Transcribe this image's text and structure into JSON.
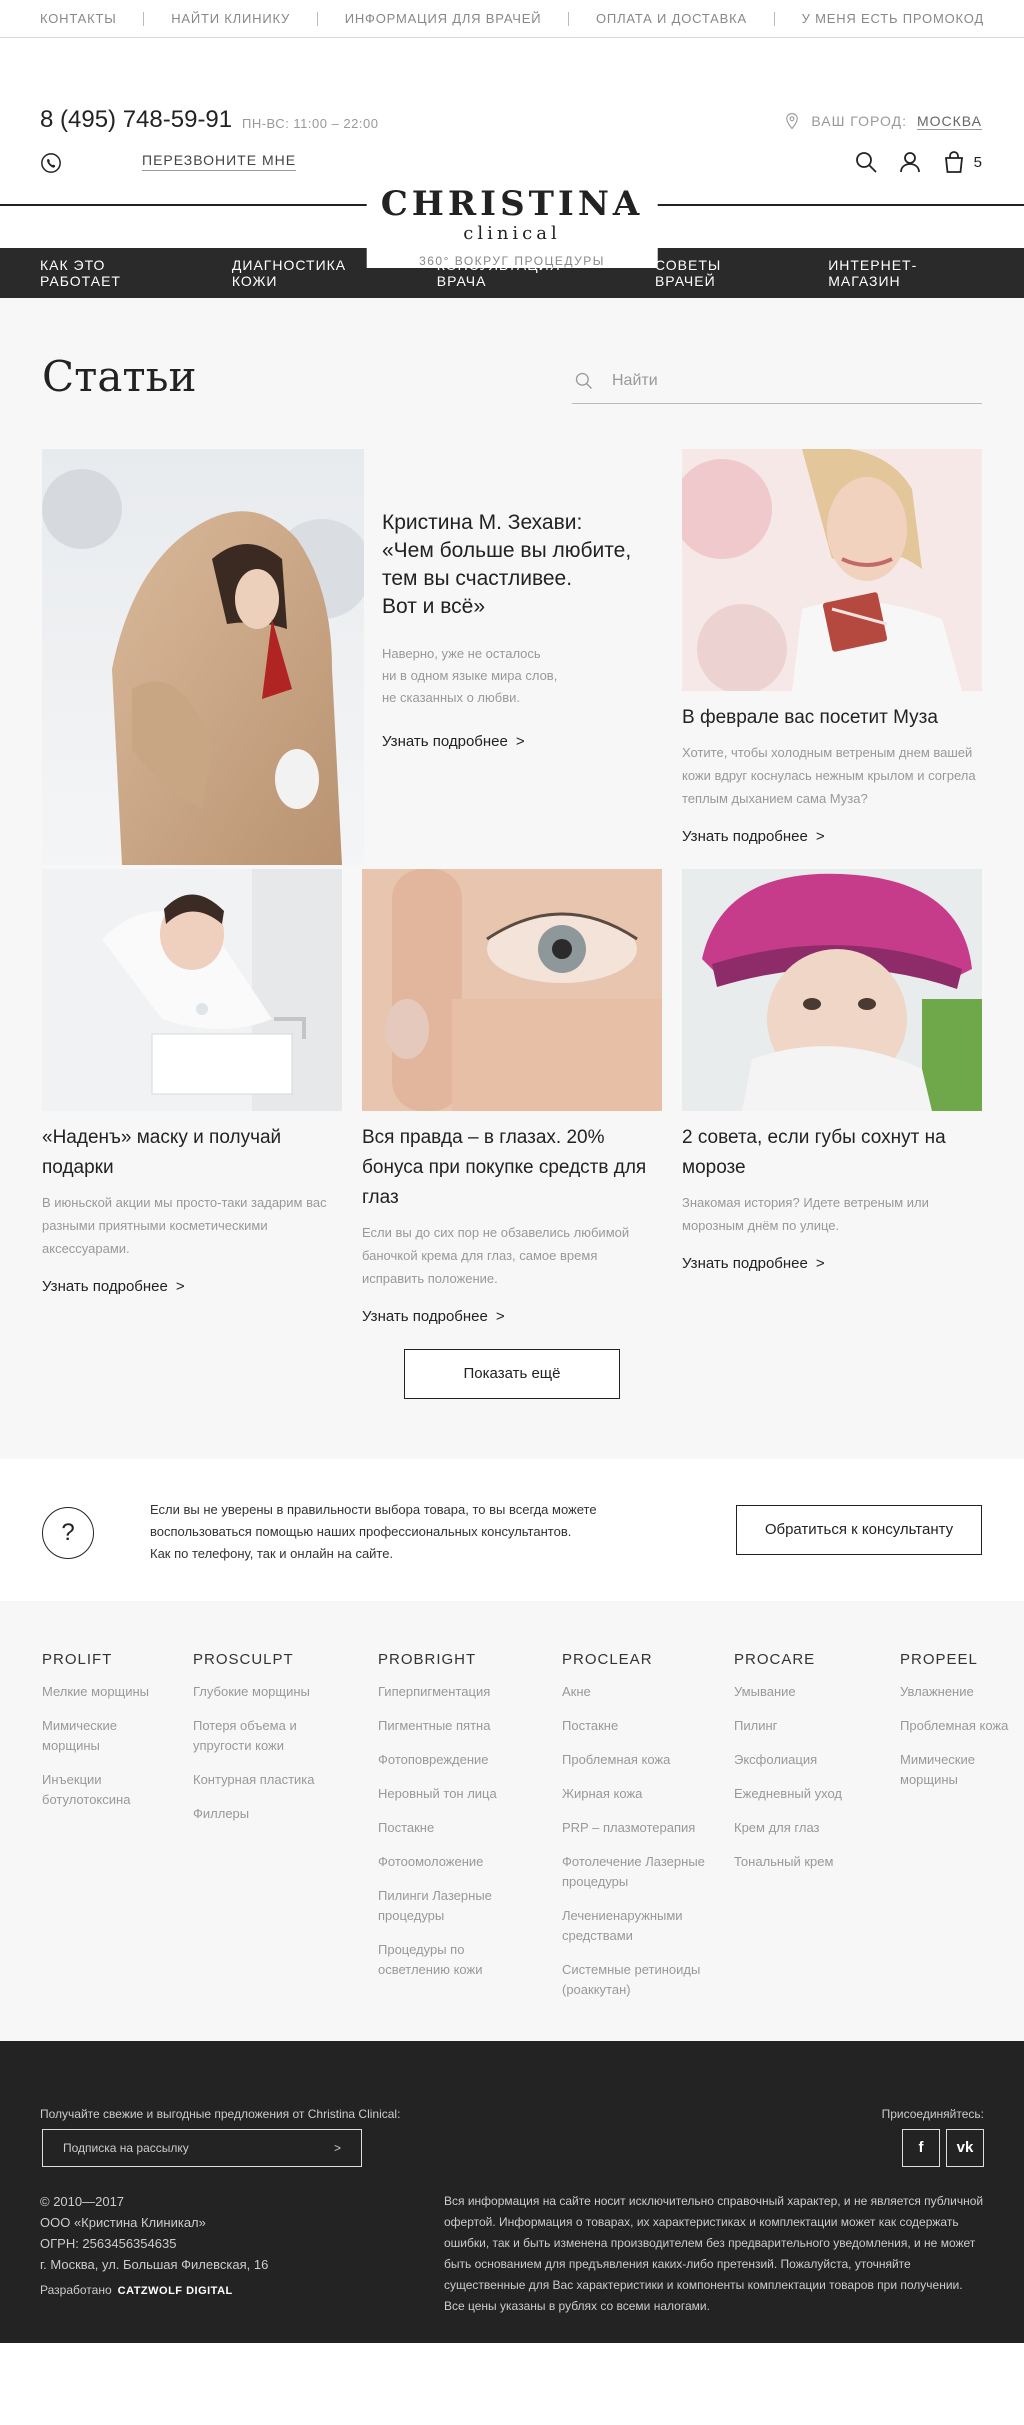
{
  "topbar": {
    "links": [
      "КОНТАКТЫ",
      "НАЙТИ КЛИНИКУ",
      "ИНФОРМАЦИЯ ДЛЯ ВРАЧЕЙ",
      "ОПЛАТА И ДОСТАВКА",
      "У МЕНЯ ЕСТЬ ПРОМОКОД"
    ]
  },
  "header": {
    "phone": "8 (495) 748-59-91",
    "hours": "ПН-ВС: 11:00 – 22:00",
    "callback": "ПЕРЕЗВОНИТЕ МНЕ",
    "city_label": "ВАШ ГОРОД:",
    "city_name": "МОСКВА",
    "cart_count": "5",
    "logo_line1": "CHRISTINA",
    "logo_line2": "clinical",
    "logo_tagline": "360° ВОКРУГ ПРОЦЕДУРЫ"
  },
  "nav": {
    "items": [
      "КАК ЭТО РАБОТАЕТ",
      "ДИАГНОСТИКА КОЖИ",
      "КОНСУЛЬТАЦИЯ ВРАЧА",
      "СОВЕТЫ ВРАЧЕЙ",
      "ИНТЕРНЕТ-МАГАЗИН"
    ]
  },
  "main": {
    "title": "Статьи",
    "search_placeholder": "Найти",
    "more_label": "Узнать подробнее",
    "featured": {
      "title_line1": "Кристина М. Зехави:",
      "title_line2": "«Чем больше вы любите,",
      "title_line3": "тем вы счастливее.",
      "title_line4": "Вот и всё»",
      "desc_line1": "Наверно, уже не осталось",
      "desc_line2": "ни в одном языке мира слов,",
      "desc_line3": "не сказанных о любви."
    },
    "cards": [
      {
        "title": "В феврале вас посетит Муза",
        "desc": "Хотите, чтобы холодным ветреным днем вашей кожи вдруг коснулась нежным крылом и согрела теплым дыханием сама Муза?"
      },
      {
        "title": "«Наденъ» маску и получай подарки",
        "desc": "В июньской акции мы просто-таки задарим вас разными приятными косметическими аксессуарами."
      },
      {
        "title": "Вся правда – в глазах. 20% бонуса при покупке средств для глаз",
        "desc": "Если вы до сих пор не обзавелись любимой баночкой крема для глаз, самое время исправить положение."
      },
      {
        "title": "2 совета, если губы сохнут на морозе",
        "desc": "Знакомая история? Идете ветреным или морозным днём по улице."
      }
    ],
    "show_more": "Показать ещё"
  },
  "consult": {
    "icon": "?",
    "text_line1": "Если вы не уверены в правильности выбора товара, то вы всегда можете",
    "text_line2": "воспользоваться помощью наших профессиональных консультантов.",
    "text_line3": "Как по телефону, так и онлайн на сайте.",
    "button": "Обратиться к консультанту"
  },
  "categories": [
    {
      "title": "PROLIFT",
      "items": [
        "Мелкие морщины",
        "Мимические морщины",
        "Инъекции ботулотоксина"
      ]
    },
    {
      "title": "PROSCULPT",
      "items": [
        "Глубокие морщины",
        "Потеря объема и упругости кожи",
        "Контурная пластика",
        "Филлеры"
      ]
    },
    {
      "title": "PROBRIGHT",
      "items": [
        "Гиперпигментация",
        "Пигментные пятна",
        "Фотоповреждение",
        "Неровный тон лица",
        "Постакне",
        "Фотоомоложение",
        "Пилинги Лазерные процедуры",
        "Процедуры по осветлению кожи"
      ]
    },
    {
      "title": "PROCLEAR",
      "items": [
        "Акне",
        "Постакне",
        "Проблемная кожа",
        "Жирная кожа",
        "PRP – плазмотерапия",
        "Фотолечение Лазерные процедуры",
        "Лечениенаружными средствами",
        "Системные ретиноиды (роаккутан)"
      ]
    },
    {
      "title": "PROCARE",
      "items": [
        "Умывание",
        "Пилинг",
        "Эксфолиация",
        "Ежедневный уход",
        "Крем для глаз",
        "Тональный крем"
      ]
    },
    {
      "title": "PROPEEL",
      "items": [
        "Увлажнение",
        "Проблемная кожа",
        "Мимические морщины"
      ]
    }
  ],
  "footer": {
    "subscribe_label": "Получайте свежие и выгодные предложения от Christina Clinical:",
    "subscribe_placeholder": "Подписка на рассылку",
    "subscribe_arrow": ">",
    "join_label": "Присоединяйтесь:",
    "facebook": "f",
    "vk": "vk",
    "copy_line1": "© 2010—2017",
    "copy_line2": "ООО «Кристина Клиникал»",
    "copy_line3": "ОГРН: 2563456354635",
    "copy_line4": "г. Москва, ул. Большая Филевская, 16",
    "developed_label": "Разработано",
    "developer": "CATZWOLF DIGITAL",
    "disclaimer": "Вся информация на сайте носит исключительно справочный характер, и не является публичной офертой. Информация о товарах, их характеристиках и комплектации может как содержать ошибки, так и быть изменена производителем без предварительного уведомления, и не может быть основанием для предъявления каких-либо претензий. Пожалуйста, уточняйте существенные для Вас характеристики и компоненты комплектации товаров при получении. Все цены указаны в рублях со всеми налогами."
  }
}
